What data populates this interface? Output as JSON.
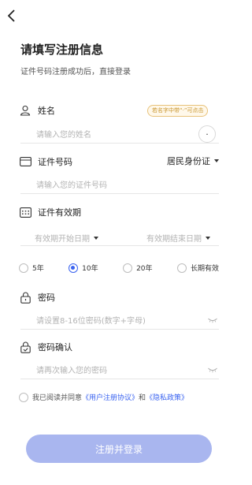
{
  "header": {
    "title": "请填写注册信息",
    "subtitle": "证件号码注册成功后，直接登录"
  },
  "name": {
    "label": "姓名",
    "hint": "若名字中带“·”可点击",
    "placeholder": "请输入您的姓名",
    "dot_button": "·"
  },
  "id_number": {
    "label": "证件号码",
    "doc_type": "居民身份证",
    "placeholder": "请输入您的证件号码"
  },
  "validity": {
    "label": "证件有效期",
    "start_placeholder": "有效期开始日期",
    "end_placeholder": "有效期结束日期",
    "options": [
      {
        "label": "5年",
        "selected": false
      },
      {
        "label": "10年",
        "selected": true
      },
      {
        "label": "20年",
        "selected": false
      },
      {
        "label": "长期有效",
        "selected": false
      }
    ]
  },
  "password": {
    "label": "密码",
    "placeholder": "请设置8-16位密码(数字+字母)"
  },
  "password_confirm": {
    "label": "密码确认",
    "placeholder": "请再次输入您的密码"
  },
  "agreement": {
    "prefix": "我已阅读并同意",
    "user_agreement": "《用户注册协议》",
    "and": "和",
    "privacy_policy": "《隐私政策》"
  },
  "submit_label": "注册并登录",
  "colors": {
    "accent": "#3a63f0",
    "button_disabled": "#a9b6ef",
    "hint_border": "#e8c27a"
  }
}
